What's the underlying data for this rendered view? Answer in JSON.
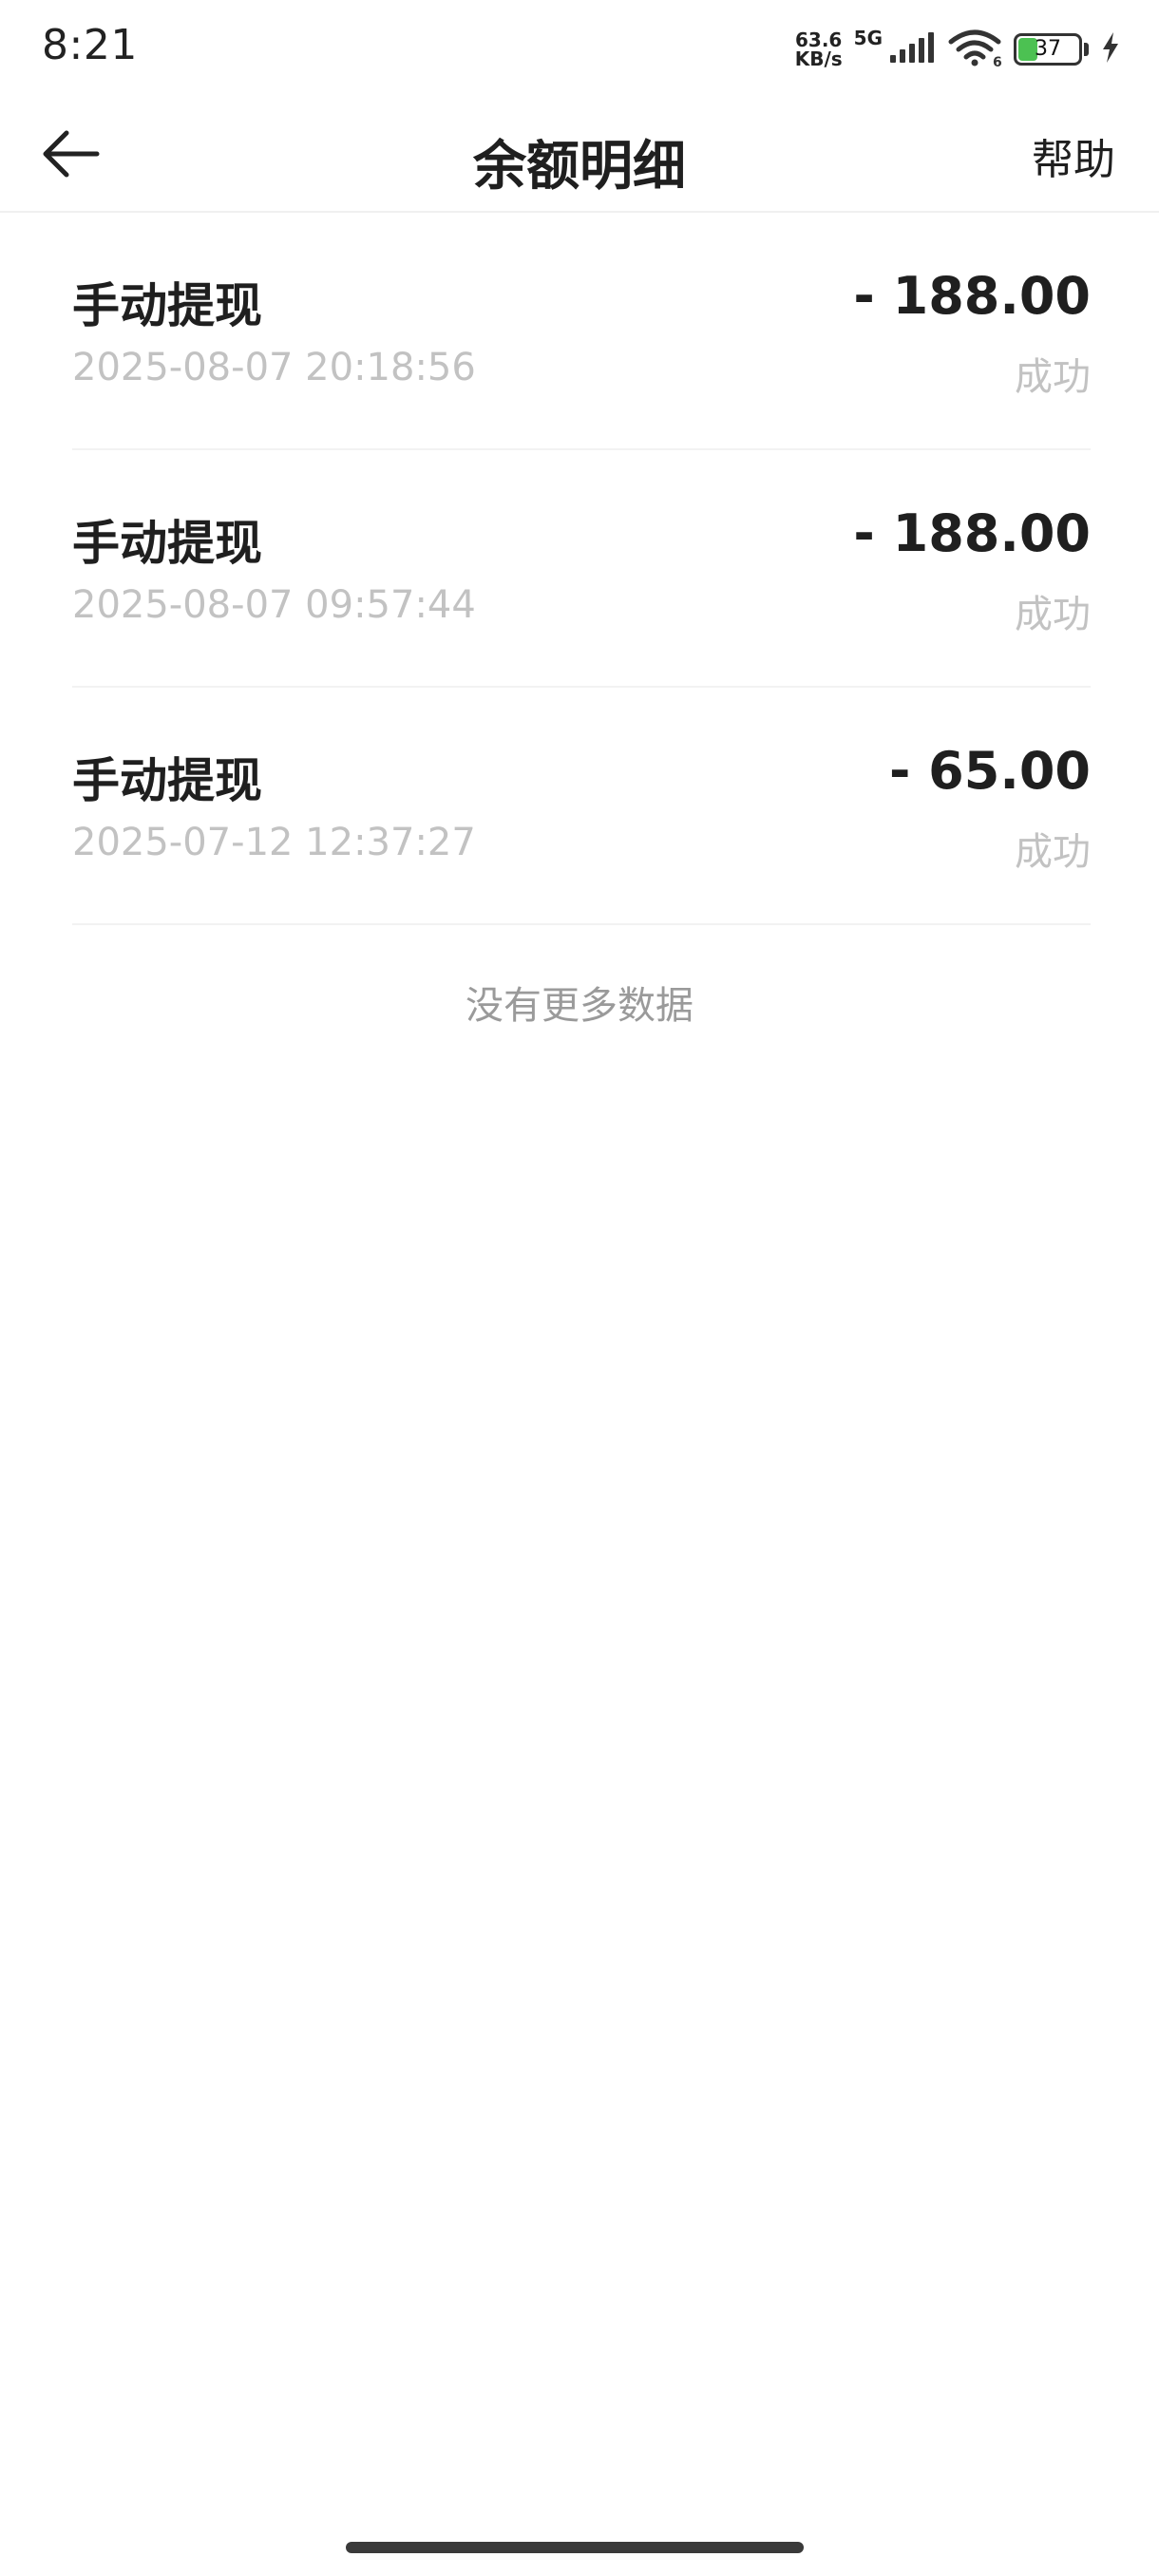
{
  "status_bar": {
    "time": "8:21",
    "net_speed_value": "63.6",
    "net_speed_unit": "KB/s",
    "network_type": "5G",
    "battery_level": "37",
    "battery_fraction": 0.37,
    "icons": [
      "signal-icon",
      "wifi-icon",
      "battery-icon",
      "charging-icon"
    ]
  },
  "header": {
    "title": "余额明细",
    "help_label": "帮助",
    "back_icon": "arrow-left-icon"
  },
  "records": [
    {
      "title": "手动提现",
      "time": "2025-08-07 20:18:56",
      "amount": "- 188.00",
      "status": "成功"
    },
    {
      "title": "手动提现",
      "time": "2025-08-07 09:57:44",
      "amount": "- 188.00",
      "status": "成功"
    },
    {
      "title": "手动提现",
      "time": "2025-07-12 12:37:27",
      "amount": "- 65.00",
      "status": "成功"
    }
  ],
  "footer": {
    "no_more_text": "没有更多数据"
  }
}
